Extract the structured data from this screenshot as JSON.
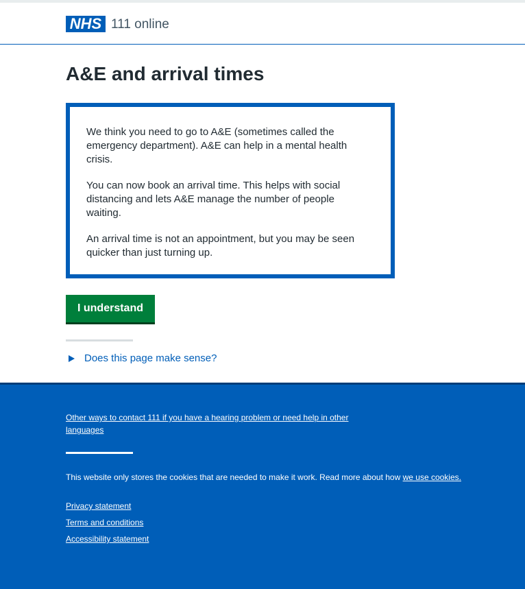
{
  "header": {
    "logo_text": "NHS",
    "service_name": "111 online",
    "brand_color": "#005eb8"
  },
  "main": {
    "title": "A&E and arrival times",
    "care_card": {
      "paragraphs": [
        "We think you need to go to A&E (sometimes called the emergency department). A&E can help in a mental health crisis.",
        "You can now book an arrival time. This helps with social distancing and lets A&E manage the number of people waiting.",
        "An arrival time is not an appointment, but you may be seen quicker than just turning up."
      ]
    },
    "button_label": "I understand",
    "button_color": "#007f3b",
    "feedback_label": "Does this page make sense?"
  },
  "footer": {
    "contact_link": "Other ways to contact 111 if you have a hearing problem or need help in other languages",
    "cookie_text": "This website only stores the cookies that are needed to make it work. Read more about how ",
    "cookie_link": "we use cookies.",
    "links": [
      "Privacy statement",
      "Terms and conditions",
      "Accessibility statement"
    ]
  }
}
